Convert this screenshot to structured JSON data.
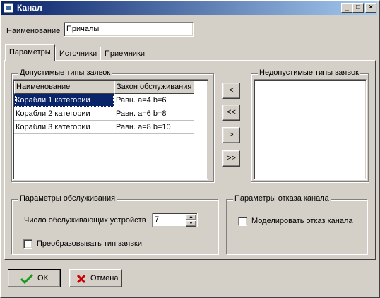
{
  "window": {
    "title": "Канал",
    "minimize": "_",
    "maximize": "□",
    "close": "×"
  },
  "name_field": {
    "label": "Наименование",
    "value": "Причалы"
  },
  "tabs": [
    {
      "label": "Параметры",
      "active": true
    },
    {
      "label": "Источники",
      "active": false
    },
    {
      "label": "Приемники",
      "active": false
    }
  ],
  "allowed": {
    "legend": "Допустимые типы заявок",
    "columns": [
      "Наименование",
      "Закон обслуживания"
    ],
    "rows": [
      [
        "Корабли 1 категории",
        "Равн. a=4 b=6"
      ],
      [
        "Корабли 2 категории",
        "Равн. a=6 b=8"
      ],
      [
        "Корабли 3 категории",
        "Равн. a=8 b=10"
      ]
    ]
  },
  "transfer_buttons": [
    "<",
    "<<",
    ">",
    ">>"
  ],
  "disallowed": {
    "legend": "Недопустимые типы заявок"
  },
  "service": {
    "legend": "Параметры обслуживания",
    "devices_label": "Число обслуживающих устройств",
    "devices_value": "7",
    "convert_label": "Преобразовывать тип заявки"
  },
  "failure": {
    "legend": "Параметры отказа канала",
    "model_label": "Моделировать отказ канала"
  },
  "footer": {
    "ok_label": "OK",
    "cancel_label": "Отмена"
  },
  "colors": {
    "title_start": "#0a246a",
    "title_end": "#a6caf0",
    "selection": "#0a246a",
    "ok_check": "#1a9a1a",
    "cancel_x": "#cc0000"
  }
}
